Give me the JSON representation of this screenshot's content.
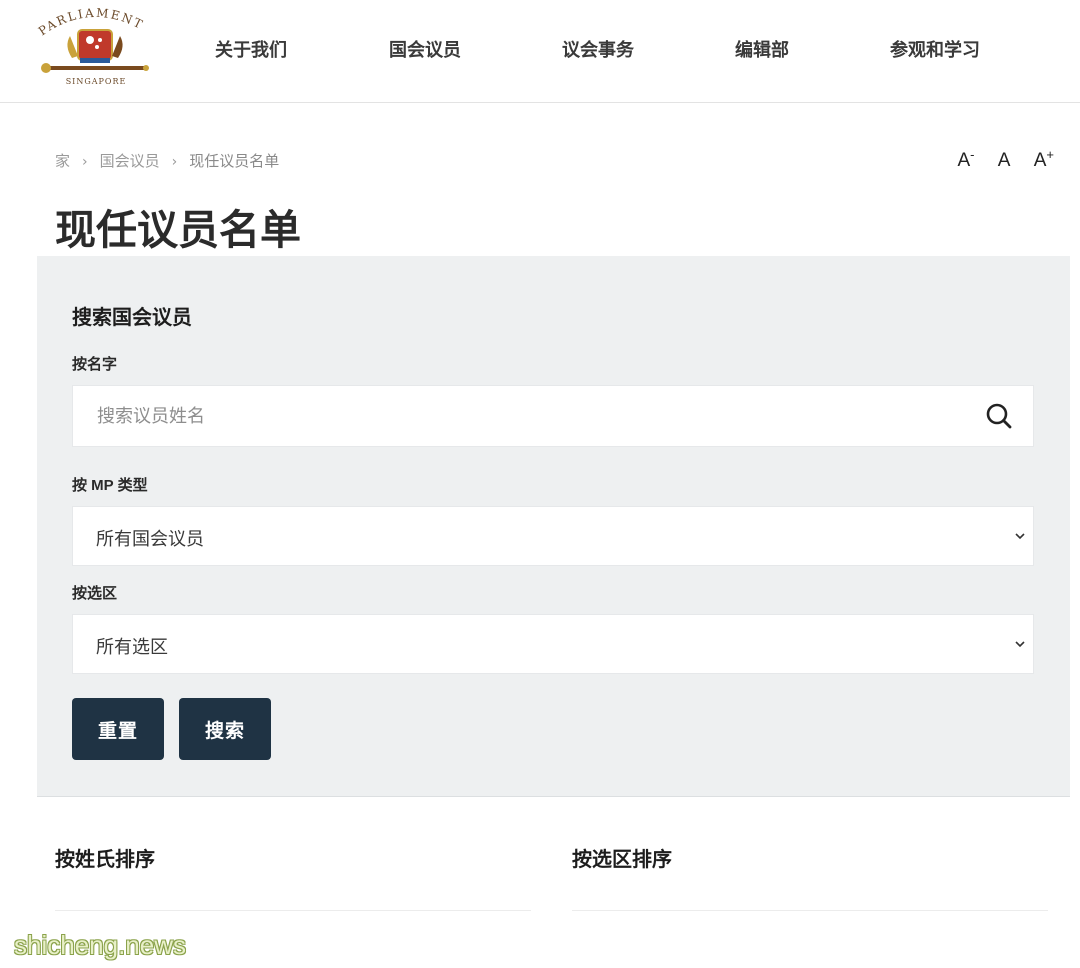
{
  "logo": {
    "arc_text": "PARLIAMENT",
    "sub_text": "SINGAPORE",
    "colors": {
      "red": "#c0392b",
      "gold": "#c9a23a",
      "brown": "#7a4a1e"
    }
  },
  "nav": {
    "items": [
      {
        "label": "关于我们"
      },
      {
        "label": "国会议员"
      },
      {
        "label": "议会事务"
      },
      {
        "label": "编辑部"
      },
      {
        "label": "参观和学习"
      }
    ]
  },
  "breadcrumb": {
    "home": "家",
    "sep": "›",
    "parent": "国会议员",
    "current": "现任议员名单"
  },
  "font_controls": {
    "decrease_base": "A",
    "decrease_mark": "-",
    "normal": "A",
    "increase_base": "A",
    "increase_mark": "+"
  },
  "page_title": "现任议员名单",
  "search": {
    "heading": "搜索国会议员",
    "by_name_label": "按名字",
    "name_placeholder": "搜索议员姓名",
    "by_type_label": "按 MP 类型",
    "type_value": "所有国会议员",
    "by_constituency_label": "按选区",
    "constituency_value": "所有选区",
    "reset_label": "重置",
    "search_label": "搜索"
  },
  "sort": {
    "by_surname": "按姓氏排序",
    "by_constituency": "按选区排序"
  },
  "watermark": "shicheng.news",
  "colors": {
    "panel_bg": "#eef0f1",
    "button_bg": "#1f3344",
    "button_text": "#ffffff"
  }
}
